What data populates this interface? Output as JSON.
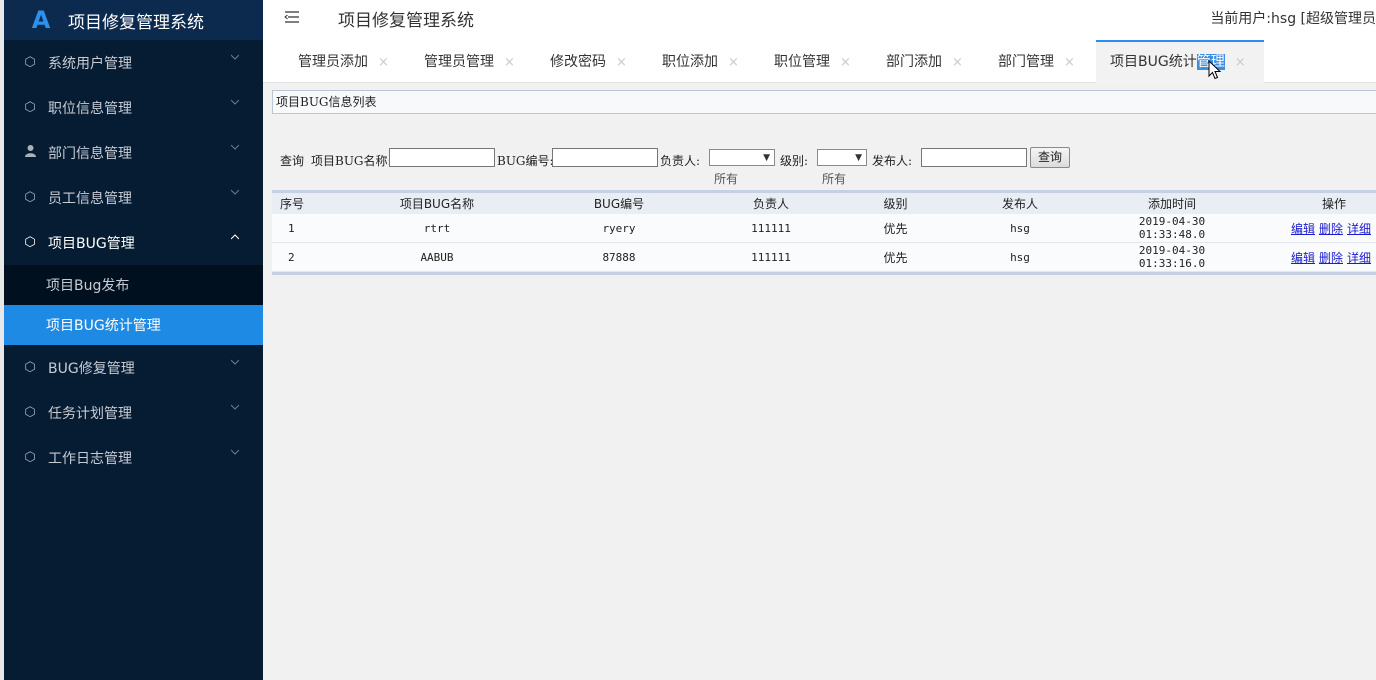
{
  "app": {
    "title": "项目修复管理系统",
    "logo_letter": "A"
  },
  "header": {
    "page_title": "项目修复管理系统",
    "user_info": "当前用户:hsg [超级管理员"
  },
  "sidebar": {
    "items": [
      {
        "label": "系统用户管理",
        "icon": "cube-icon"
      },
      {
        "label": "职位信息管理",
        "icon": "cube-icon"
      },
      {
        "label": "部门信息管理",
        "icon": "user-icon"
      },
      {
        "label": "员工信息管理",
        "icon": "cube-icon"
      },
      {
        "label": "项目BUG管理",
        "icon": "cube-icon",
        "expanded": true,
        "children": [
          {
            "label": "项目Bug发布"
          },
          {
            "label": "项目BUG统计管理",
            "active": true
          }
        ]
      },
      {
        "label": "BUG修复管理",
        "icon": "cube-icon"
      },
      {
        "label": "任务计划管理",
        "icon": "cube-icon"
      },
      {
        "label": "工作日志管理",
        "icon": "cube-icon"
      }
    ]
  },
  "tabs": [
    {
      "label": "管理员添加"
    },
    {
      "label": "管理员管理"
    },
    {
      "label": "修改密码"
    },
    {
      "label": "职位添加"
    },
    {
      "label": "职位管理"
    },
    {
      "label": "部门添加"
    },
    {
      "label": "部门管理"
    },
    {
      "label_pre": "项目BUG统计",
      "label_hl": "管理",
      "active": true
    }
  ],
  "tab_close": "×",
  "panel": {
    "title": "项目BUG信息列表"
  },
  "search": {
    "query_label": "查询",
    "name_label": "项目BUG名称:",
    "name_value": "",
    "code_label": "BUG编号:",
    "code_value": "",
    "owner_label": "负责人:",
    "owner_selected": "所有",
    "level_label": "级别:",
    "level_selected": "所有",
    "publisher_label": "发布人:",
    "publisher_value": "",
    "button": "查询"
  },
  "table": {
    "headers": [
      "序号",
      "项目BUG名称",
      "BUG编号",
      "负责人",
      "级别",
      "发布人",
      "添加时间",
      "操作"
    ],
    "rows": [
      {
        "no": "1",
        "name": "rtrt",
        "code": "ryery",
        "owner": "111111",
        "level": "优先",
        "publisher": "hsg",
        "time": "2019-04-30 01:33:48.0"
      },
      {
        "no": "2",
        "name": "AABUB",
        "code": "87888",
        "owner": "111111",
        "level": "优先",
        "publisher": "hsg",
        "time": "2019-04-30 01:33:16.0"
      }
    ],
    "actions": [
      "编辑",
      "删除",
      "详细"
    ]
  }
}
